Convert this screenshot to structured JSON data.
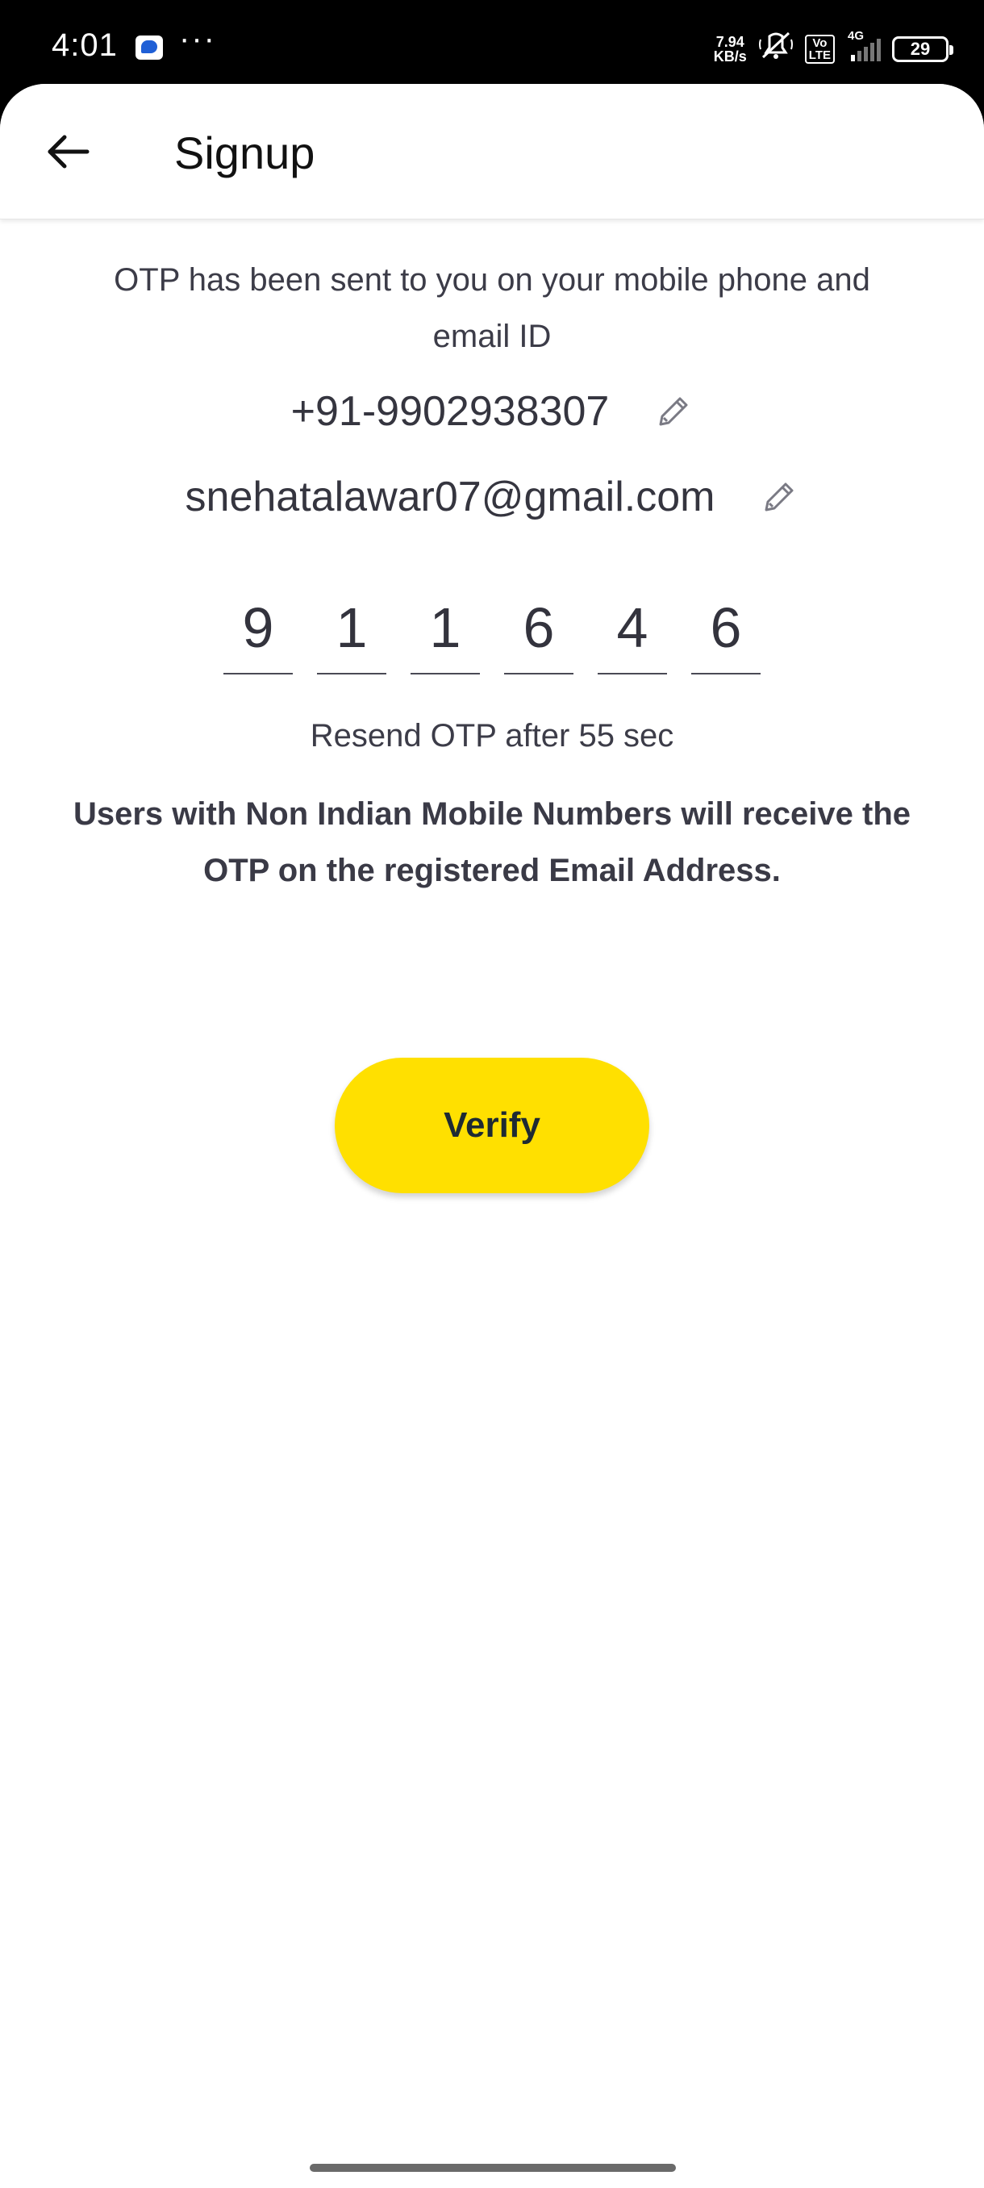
{
  "status_bar": {
    "time": "4:01",
    "more": "···",
    "net_speed_value": "7.94",
    "net_speed_unit": "KB/s",
    "volte_top": "Vo",
    "volte_bottom": "LTE",
    "network_type": "4G",
    "battery_level": "29",
    "icons": [
      "messages-app-icon",
      "mute-icon",
      "signal-icon",
      "battery-icon"
    ]
  },
  "header": {
    "title": "Signup",
    "back_icon": "arrow-back-icon"
  },
  "otp_screen": {
    "info_text": "OTP has been sent to you on your mobile phone and email ID",
    "phone": "+91-9902938307",
    "email": "snehatalawar07@gmail.com",
    "edit_icon": "pencil-icon",
    "otp_digits": [
      "9",
      "1",
      "1",
      "6",
      "4",
      "6"
    ],
    "resend_text": "Resend OTP after 55 sec",
    "notice_text": "Users with Non Indian Mobile Numbers will receive the OTP on the registered Email Address.",
    "verify_label": "Verify"
  },
  "colors": {
    "accent": "#ffe000",
    "text_primary": "#3a3a46",
    "status_bar_bg": "#000000"
  }
}
